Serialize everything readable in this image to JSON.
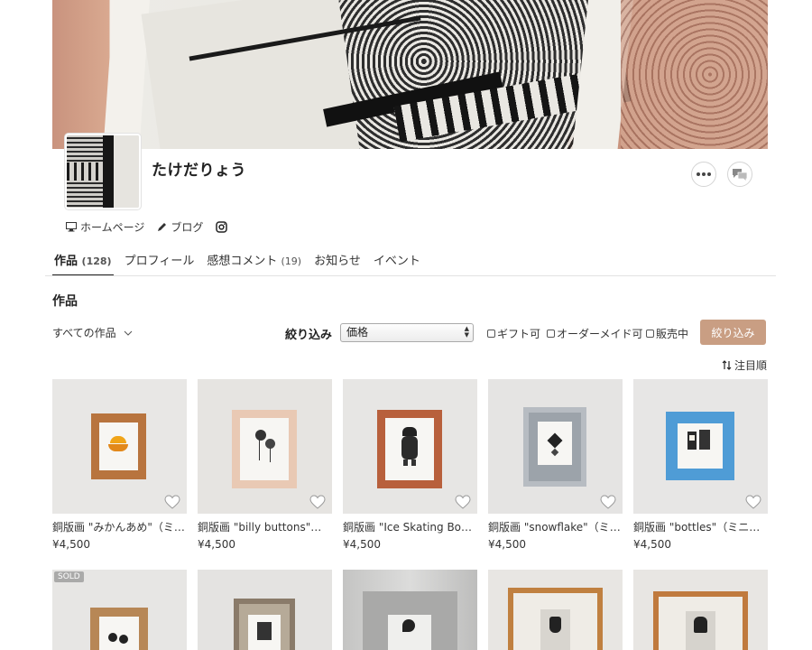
{
  "profile": {
    "name": "たけだりょう"
  },
  "links": {
    "homepage": "ホームページ",
    "blog": "ブログ"
  },
  "tabs": [
    {
      "label": "作品",
      "count": "(128)"
    },
    {
      "label": "プロフィール",
      "count": ""
    },
    {
      "label": "感想コメント",
      "count": "(19)"
    },
    {
      "label": "お知らせ",
      "count": ""
    },
    {
      "label": "イベント",
      "count": ""
    }
  ],
  "section_title": "作品",
  "filters": {
    "all_works": "すべての作品",
    "filter_label": "絞り込み",
    "select_value": "価格",
    "gift": "ギフト可",
    "order_made": "オーダーメイド可",
    "on_sale": "販売中",
    "button": "絞り込み",
    "sort": "注目順"
  },
  "items": [
    {
      "title": "銅版画 \"みかんあめ\"（ミニ額）",
      "price": "¥4,500"
    },
    {
      "title": "銅版画 \"billy buttons\"（ミニ額）",
      "price": "¥4,500"
    },
    {
      "title": "銅版画 \"Ice Skating Boy\"（ミニ額）",
      "price": "¥4,500"
    },
    {
      "title": "銅版画 \"snowflake\"（ミニ額）",
      "price": "¥4,500"
    },
    {
      "title": "銅版画 \"bottles\"（ミニ額）",
      "price": "¥4,500"
    }
  ],
  "sold_badge": "SOLD",
  "colors": {
    "accent_button": "#c99e83"
  }
}
